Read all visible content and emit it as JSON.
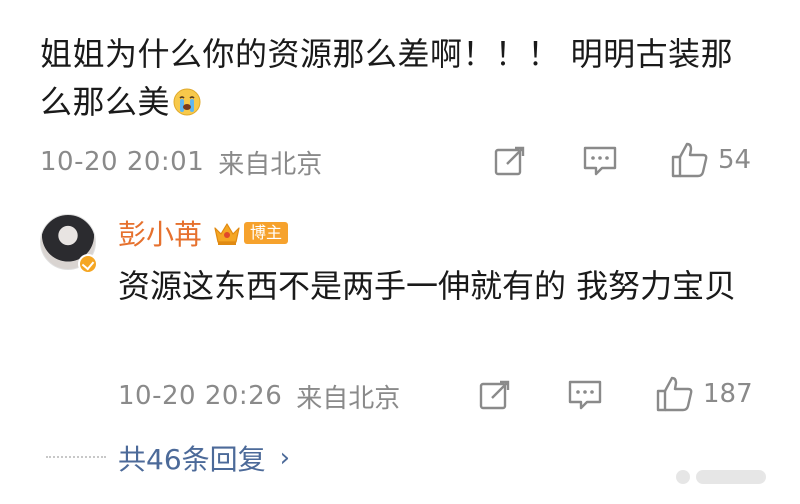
{
  "comment": {
    "text": "姐姐为什么你的资源那么差啊！！！ 明明古装那么那么美",
    "emoji_icon": "crying-face-icon",
    "time": "10-20 20:01",
    "location": "来自北京",
    "like_count": "54"
  },
  "reply": {
    "author": "彭小苒",
    "role_badge": "博主",
    "text": "资源这东西不是两手一伸就有的 我努力宝贝",
    "time": "10-20 20:26",
    "location": "来自北京",
    "like_count": "187",
    "name_color": "#e6712e"
  },
  "more_replies": {
    "label": "共46条回复",
    "chevron": "›"
  },
  "icons": {
    "share": "share-icon",
    "comment": "comment-icon",
    "like": "thumbs-up-icon",
    "crown": "crown-icon",
    "verified": "verified-badge-icon"
  },
  "colors": {
    "meta_gray": "#8a8a8a",
    "link_blue": "#4c6a99",
    "badge_orange": "#f6a22d"
  }
}
